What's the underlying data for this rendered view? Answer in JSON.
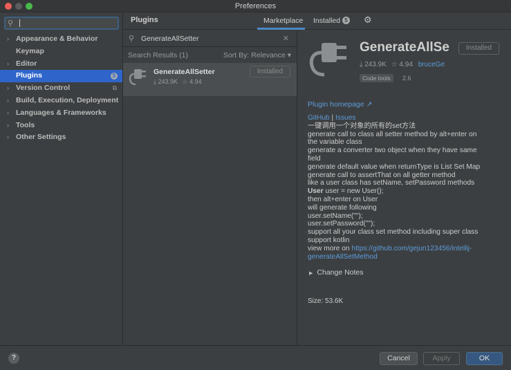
{
  "window": {
    "title": "Preferences"
  },
  "sidebar": {
    "search_placeholder": "",
    "items": [
      {
        "label": "Appearance & Behavior",
        "arrow": "›"
      },
      {
        "label": "Keymap",
        "arrow": ""
      },
      {
        "label": "Editor",
        "arrow": "›"
      },
      {
        "label": "Plugins",
        "arrow": "",
        "badge": "5",
        "selected": true
      },
      {
        "label": "Version Control",
        "arrow": "›"
      },
      {
        "label": "Build, Execution, Deployment",
        "arrow": "›"
      },
      {
        "label": "Languages & Frameworks",
        "arrow": "›"
      },
      {
        "label": "Tools",
        "arrow": "›"
      },
      {
        "label": "Other Settings",
        "arrow": "›"
      }
    ]
  },
  "header": {
    "title": "Plugins",
    "tabs": {
      "marketplace": "Marketplace",
      "installed": "Installed",
      "installed_count": "5"
    }
  },
  "list": {
    "search_query": "GenerateAllSetter",
    "results_label": "Search Results (1)",
    "sort_label": "Sort By: Relevance ▾",
    "result": {
      "name": "GenerateAllSetter",
      "downloads": "⤓ 243.9K",
      "rating": "☆ 4.94",
      "button": "Installed"
    }
  },
  "detail": {
    "title": "GenerateAllSe",
    "installed_button": "Installed",
    "downloads": "⤓ 243.9K",
    "rating": "☆ 4.94",
    "vendor": "bruceGe",
    "tag": "Code tools",
    "version": "2.6",
    "homepage": "Plugin homepage ↗",
    "github": "GitHub",
    "sep": " | ",
    "issues": "Issues",
    "lines": [
      "一键调用一个对象的所有的set方法",
      "generate call to class all setter method by alt+enter on",
      "the variable class",
      "generate a converter two object when they have same",
      "field",
      "generate default value when returnType is List Set Map",
      "generate call to assertThat on all getter method",
      "like a user class has setName, setPassword methods"
    ],
    "code_bold": "User",
    "code_rest": " user = new User();",
    "lines2": [
      "then alt+enter on User",
      "will generate following",
      "user.setName(\"\");",
      "user.setPassword(\"\");",
      "support all your class set method including super class",
      "support kotlin"
    ],
    "view_more": "view more on ",
    "url_1": "https://github.com/gejun123456/intellij-",
    "url_2": "generateAllSetMethod",
    "change_notes": "Change Notes",
    "size": "Size: 53.6K"
  },
  "footer": {
    "help": "?",
    "cancel": "Cancel",
    "apply": "Apply",
    "ok": "OK"
  },
  "colors": {
    "accent": "#2f65ca",
    "link": "#5d9bd9",
    "ok_button": "#365880",
    "background": "#3c3f41"
  }
}
